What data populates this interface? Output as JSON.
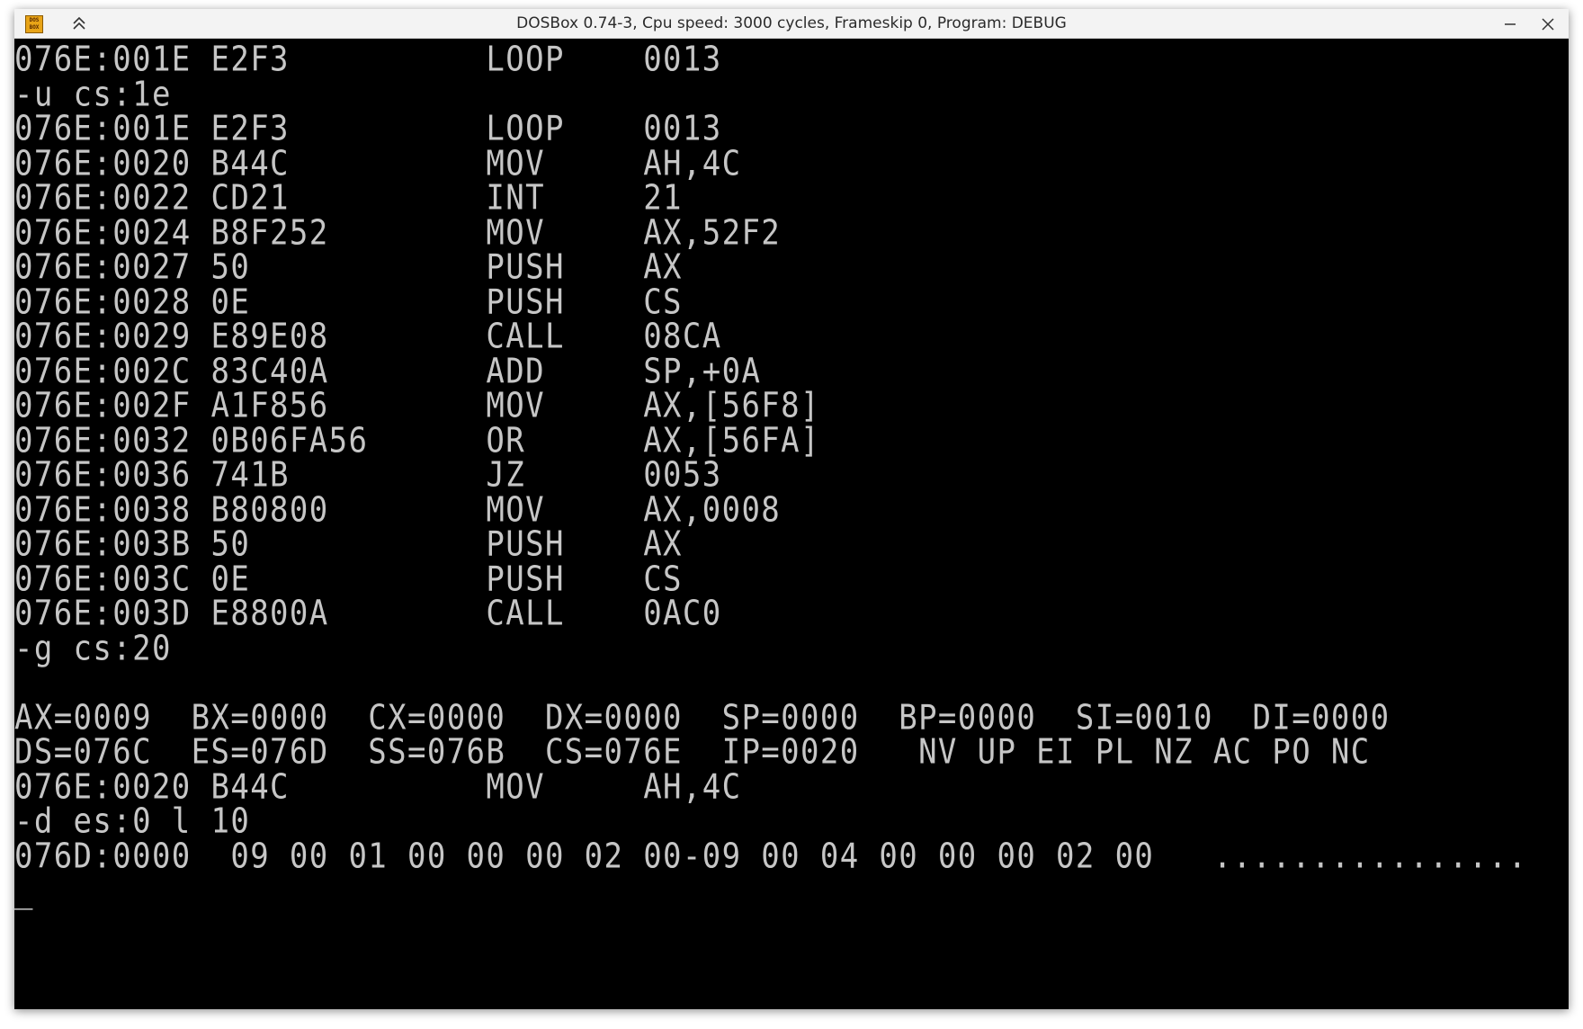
{
  "window": {
    "title": "DOSBox 0.74-3, Cpu speed: 3000 cycles, Frameskip 0, Program: DEBUG",
    "app_icon_text_top": "DOS",
    "app_icon_text_bottom": "BOX"
  },
  "terminal": {
    "lines": [
      "076E:001E E2F3          LOOP    0013",
      "-u cs:1e",
      "076E:001E E2F3          LOOP    0013",
      "076E:0020 B44C          MOV     AH,4C",
      "076E:0022 CD21          INT     21",
      "076E:0024 B8F252        MOV     AX,52F2",
      "076E:0027 50            PUSH    AX",
      "076E:0028 0E            PUSH    CS",
      "076E:0029 E89E08        CALL    08CA",
      "076E:002C 83C40A        ADD     SP,+0A",
      "076E:002F A1F856        MOV     AX,[56F8]",
      "076E:0032 0B06FA56      OR      AX,[56FA]",
      "076E:0036 741B          JZ      0053",
      "076E:0038 B80800        MOV     AX,0008",
      "076E:003B 50            PUSH    AX",
      "076E:003C 0E            PUSH    CS",
      "076E:003D E8800A        CALL    0AC0",
      "-g cs:20",
      "",
      "AX=0009  BX=0000  CX=0000  DX=0000  SP=0000  BP=0000  SI=0010  DI=0000",
      "DS=076C  ES=076D  SS=076B  CS=076E  IP=0020   NV UP EI PL NZ AC PO NC",
      "076E:0020 B44C          MOV     AH,4C",
      "-d es:0 l 10",
      "076D:0000  09 00 01 00 00 00 02 00-09 00 04 00 00 00 02 00   ................",
      "_"
    ]
  }
}
